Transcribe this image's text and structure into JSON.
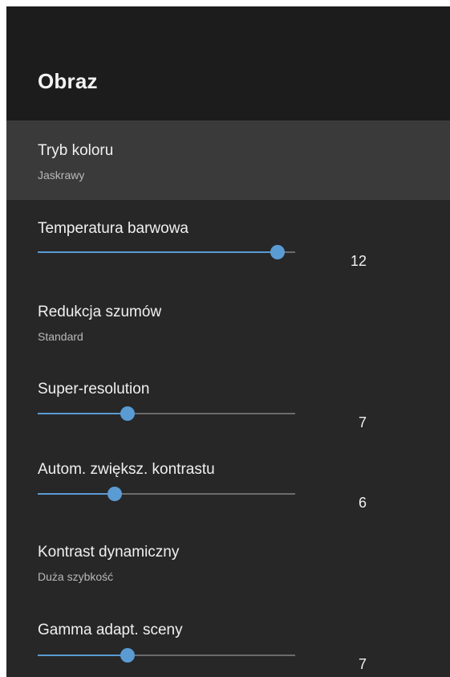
{
  "header": {
    "title": "Obraz"
  },
  "items": [
    {
      "label": "Tryb koloru",
      "value": "Jaskrawy"
    },
    {
      "label": "Temperatura barwowa",
      "slider_value": "12",
      "fraction": 0.93
    },
    {
      "label": "Redukcja szumów",
      "value": "Standard"
    },
    {
      "label": "Super-resolution",
      "slider_value": "7",
      "fraction": 0.35
    },
    {
      "label": "Autom. zwiększ. kontrastu",
      "slider_value": "6",
      "fraction": 0.3
    },
    {
      "label": "Kontrast dynamiczny",
      "value": "Duża szybkość"
    },
    {
      "label": "Gamma adapt. sceny",
      "slider_value": "7",
      "fraction": 0.35
    }
  ],
  "colors": {
    "accent": "#5a9bd4",
    "background": "#272727",
    "header": "#1c1c1c",
    "highlight": "#3a3a3a"
  }
}
